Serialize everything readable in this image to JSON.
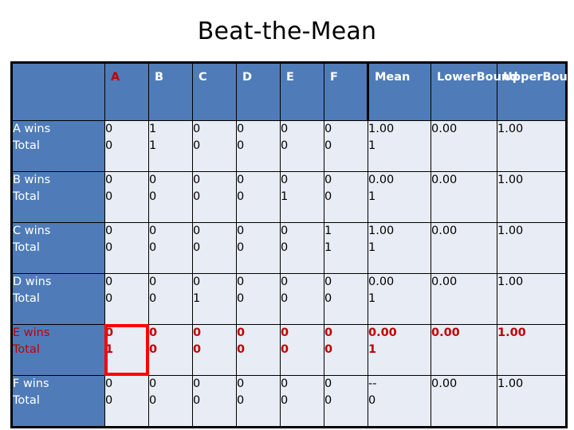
{
  "slide": {
    "title": "Beat-the-Mean"
  },
  "colors": {
    "header_blue": "#4f7cb8",
    "cell_bg": "#e8ecf4",
    "highlight_text": "#c00000",
    "highlight_box": "#ff0000",
    "border": "#000000",
    "header_text": "#ffffff"
  },
  "table": {
    "header": {
      "corner": "",
      "columns": [
        "A",
        "B",
        "C",
        "D",
        "E",
        "F"
      ],
      "highlighted_column": "A",
      "mean": "Mean",
      "lower_bound_line1": "Lower",
      "lower_bound_line2": "Bound",
      "upper_bound_line1": "Upper",
      "upper_bound_line2": "Bound"
    },
    "rows": [
      {
        "label_line1": "A wins",
        "label_line2": "Total",
        "highlighted": false,
        "cells": [
          {
            "wins": "0",
            "total": "0"
          },
          {
            "wins": "1",
            "total": "1"
          },
          {
            "wins": "0",
            "total": "0"
          },
          {
            "wins": "0",
            "total": "0"
          },
          {
            "wins": "0",
            "total": "0"
          },
          {
            "wins": "0",
            "total": "0"
          }
        ],
        "mean_line1": "1.00",
        "mean_line2": "1",
        "lower_bound": "0.00",
        "upper_bound": "1.00"
      },
      {
        "label_line1": "B wins",
        "label_line2": "Total",
        "highlighted": false,
        "cells": [
          {
            "wins": "0",
            "total": "0"
          },
          {
            "wins": "0",
            "total": "0"
          },
          {
            "wins": "0",
            "total": "0"
          },
          {
            "wins": "0",
            "total": "0"
          },
          {
            "wins": "0",
            "total": "1"
          },
          {
            "wins": "0",
            "total": "0"
          }
        ],
        "mean_line1": "0.00",
        "mean_line2": "1",
        "lower_bound": "0.00",
        "upper_bound": "1.00"
      },
      {
        "label_line1": "C wins",
        "label_line2": "Total",
        "highlighted": false,
        "cells": [
          {
            "wins": "0",
            "total": "0"
          },
          {
            "wins": "0",
            "total": "0"
          },
          {
            "wins": "0",
            "total": "0"
          },
          {
            "wins": "0",
            "total": "0"
          },
          {
            "wins": "0",
            "total": "0"
          },
          {
            "wins": "1",
            "total": "1"
          }
        ],
        "mean_line1": "1.00",
        "mean_line2": "1",
        "lower_bound": "0.00",
        "upper_bound": "1.00"
      },
      {
        "label_line1": "D wins",
        "label_line2": "Total",
        "highlighted": false,
        "cells": [
          {
            "wins": "0",
            "total": "0"
          },
          {
            "wins": "0",
            "total": "0"
          },
          {
            "wins": "0",
            "total": "1"
          },
          {
            "wins": "0",
            "total": "0"
          },
          {
            "wins": "0",
            "total": "0"
          },
          {
            "wins": "0",
            "total": "0"
          }
        ],
        "mean_line1": "0.00",
        "mean_line2": "1",
        "lower_bound": "0.00",
        "upper_bound": "1.00"
      },
      {
        "label_line1": "E wins",
        "label_line2": "Total",
        "highlighted": true,
        "boxed_cell_index": 0,
        "cells": [
          {
            "wins": "0",
            "total": "1"
          },
          {
            "wins": "0",
            "total": "0"
          },
          {
            "wins": "0",
            "total": "0"
          },
          {
            "wins": "0",
            "total": "0"
          },
          {
            "wins": "0",
            "total": "0"
          },
          {
            "wins": "0",
            "total": "0"
          }
        ],
        "mean_line1": "0.00",
        "mean_line2": "1",
        "lower_bound": "0.00",
        "upper_bound": "1.00"
      },
      {
        "label_line1": "F wins",
        "label_line2": "Total",
        "highlighted": false,
        "cells": [
          {
            "wins": "0",
            "total": "0"
          },
          {
            "wins": "0",
            "total": "0"
          },
          {
            "wins": "0",
            "total": "0"
          },
          {
            "wins": "0",
            "total": "0"
          },
          {
            "wins": "0",
            "total": "0"
          },
          {
            "wins": "0",
            "total": "0"
          }
        ],
        "mean_line1": "--",
        "mean_line2": "0",
        "lower_bound": "0.00",
        "upper_bound": "1.00"
      }
    ]
  }
}
